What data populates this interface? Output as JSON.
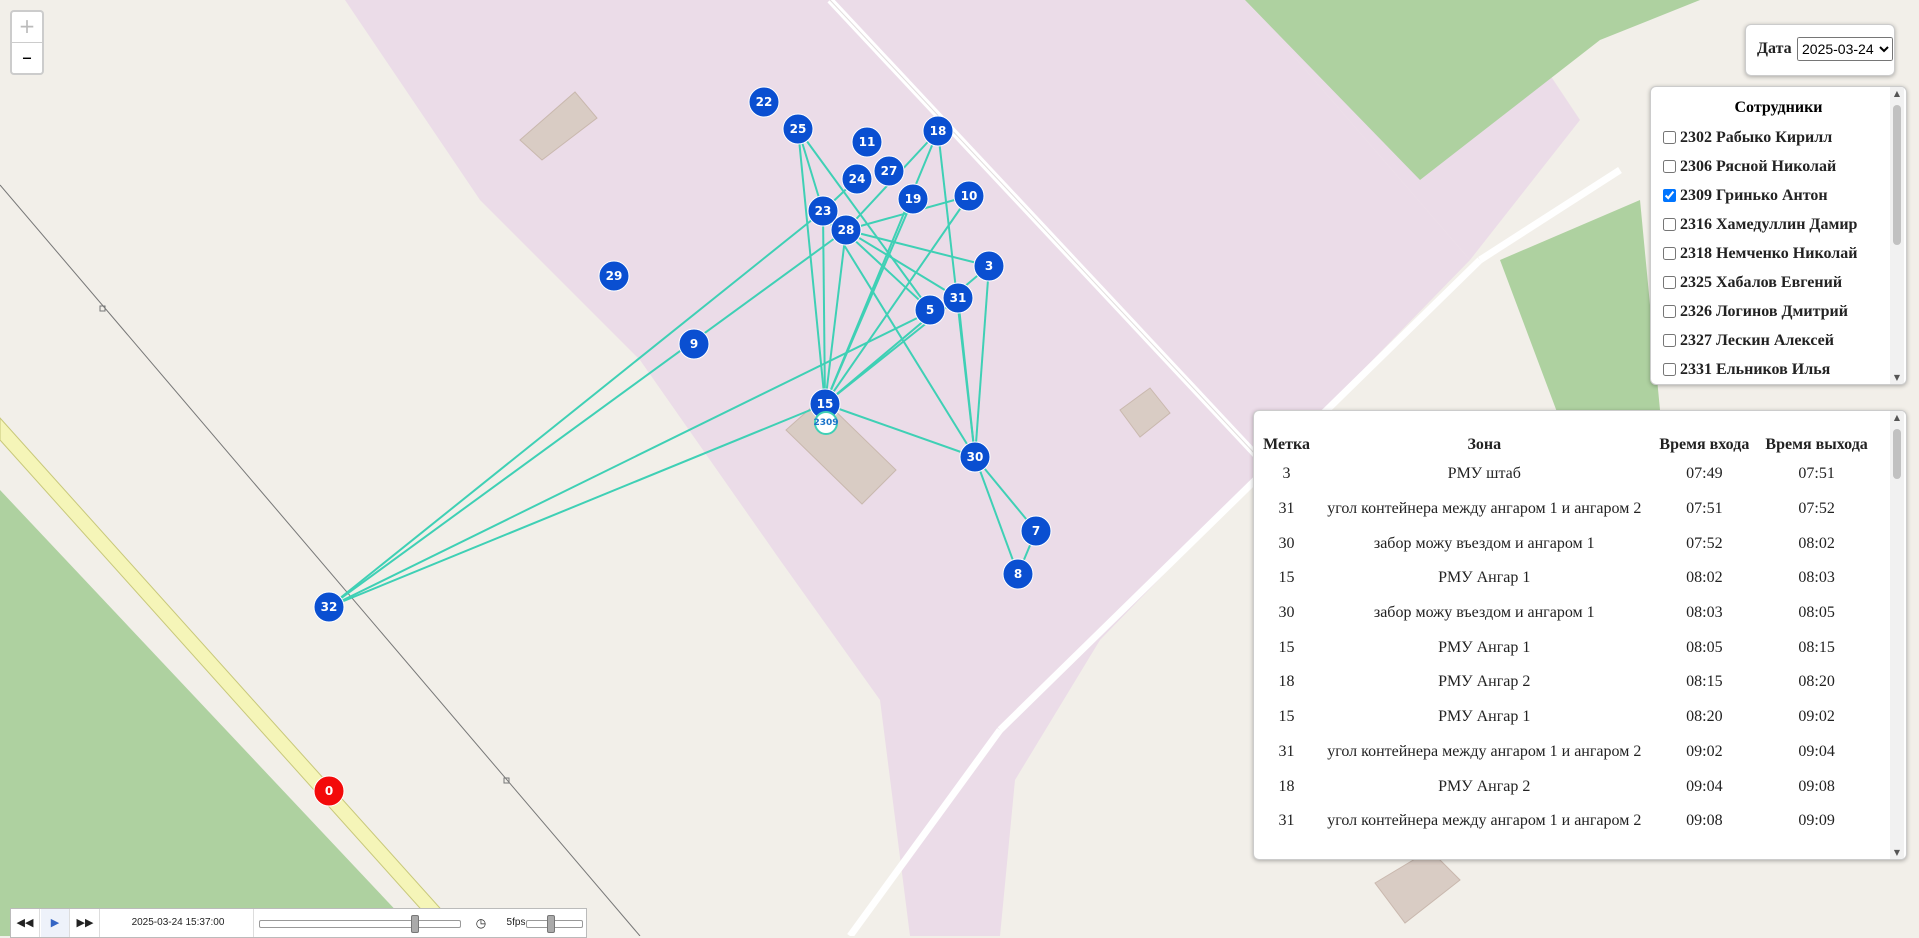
{
  "zoom": {
    "in_label": "+",
    "out_label": "–"
  },
  "date": {
    "label": "Дата",
    "selected": "2025-03-24"
  },
  "employees": {
    "title": "Сотрудники",
    "items": [
      {
        "label": "2302 Рабыко Кирилл",
        "checked": false
      },
      {
        "label": "2306 Рясной Николай",
        "checked": false
      },
      {
        "label": "2309 Гринько Антон",
        "checked": true
      },
      {
        "label": "2316 Хамедуллин Дамир",
        "checked": false
      },
      {
        "label": "2318 Немченко Николай",
        "checked": false
      },
      {
        "label": "2325 Хабалов Евгений",
        "checked": false
      },
      {
        "label": "2326 Логинов Дмитрий",
        "checked": false
      },
      {
        "label": "2327 Лескин Алексей",
        "checked": false
      },
      {
        "label": "2331 Ельников Илья",
        "checked": false
      }
    ]
  },
  "visits": {
    "headers": [
      "Метка",
      "Зона",
      "Время входа",
      "Время выхода"
    ],
    "rows": [
      [
        "3",
        "РМУ штаб",
        "07:49",
        "07:51"
      ],
      [
        "31",
        "угол контейнера между ангаром 1 и ангаром 2",
        "07:51",
        "07:52"
      ],
      [
        "30",
        "забор можу въездом и ангаром 1",
        "07:52",
        "08:02"
      ],
      [
        "15",
        "РМУ Ангар 1",
        "08:02",
        "08:03"
      ],
      [
        "30",
        "забор можу въездом и ангаром 1",
        "08:03",
        "08:05"
      ],
      [
        "15",
        "РМУ Ангар 1",
        "08:05",
        "08:15"
      ],
      [
        "18",
        "РМУ Ангар 2",
        "08:15",
        "08:20"
      ],
      [
        "15",
        "РМУ Ангар 1",
        "08:20",
        "09:02"
      ],
      [
        "31",
        "угол контейнера между ангаром 1 и ангаром 2",
        "09:02",
        "09:04"
      ],
      [
        "18",
        "РМУ Ангар 2",
        "09:04",
        "09:08"
      ],
      [
        "31",
        "угол контейнера между ангаром 1 и ангаром 2",
        "09:08",
        "09:09"
      ]
    ]
  },
  "map": {
    "colors": {
      "marker": "#0a4fd1",
      "marker_alarm": "#f30a0a",
      "track": "#3fd0b5",
      "zone": "#ebdce8",
      "grass": "#aed1a0",
      "road": "#f5f5b8"
    },
    "markers": [
      {
        "id": "22"
      },
      {
        "id": "25"
      },
      {
        "id": "11"
      },
      {
        "id": "18"
      },
      {
        "id": "27"
      },
      {
        "id": "24"
      },
      {
        "id": "19"
      },
      {
        "id": "10"
      },
      {
        "id": "23"
      },
      {
        "id": "28"
      },
      {
        "id": "3"
      },
      {
        "id": "29"
      },
      {
        "id": "31"
      },
      {
        "id": "5"
      },
      {
        "id": "9"
      },
      {
        "id": "15"
      },
      {
        "id": "30"
      },
      {
        "id": "7"
      },
      {
        "id": "8"
      },
      {
        "id": "32"
      },
      {
        "id": "0"
      }
    ],
    "tracks": [
      [
        "15",
        "23"
      ],
      [
        "15",
        "28"
      ],
      [
        "15",
        "25"
      ],
      [
        "15",
        "10"
      ],
      [
        "15",
        "3"
      ],
      [
        "15",
        "31"
      ],
      [
        "15",
        "18"
      ],
      [
        "15",
        "19"
      ],
      [
        "15",
        "30"
      ],
      [
        "15",
        "32"
      ],
      [
        "32",
        "23"
      ],
      [
        "32",
        "28"
      ],
      [
        "32",
        "31"
      ],
      [
        "25",
        "23"
      ],
      [
        "25",
        "5"
      ],
      [
        "18",
        "30"
      ],
      [
        "18",
        "28"
      ],
      [
        "23",
        "30"
      ],
      [
        "23",
        "5"
      ],
      [
        "28",
        "3"
      ],
      [
        "28",
        "31"
      ],
      [
        "3",
        "30"
      ],
      [
        "31",
        "30"
      ],
      [
        "10",
        "28"
      ],
      [
        "30",
        "7"
      ],
      [
        "30",
        "8"
      ],
      [
        "7",
        "8"
      ],
      [
        "24",
        "23"
      ]
    ],
    "current_person": "2309"
  },
  "player": {
    "datetime": "2025-03-24 15:37:00",
    "fps": "5fps",
    "progress": 0.78,
    "speed": 0.4
  }
}
